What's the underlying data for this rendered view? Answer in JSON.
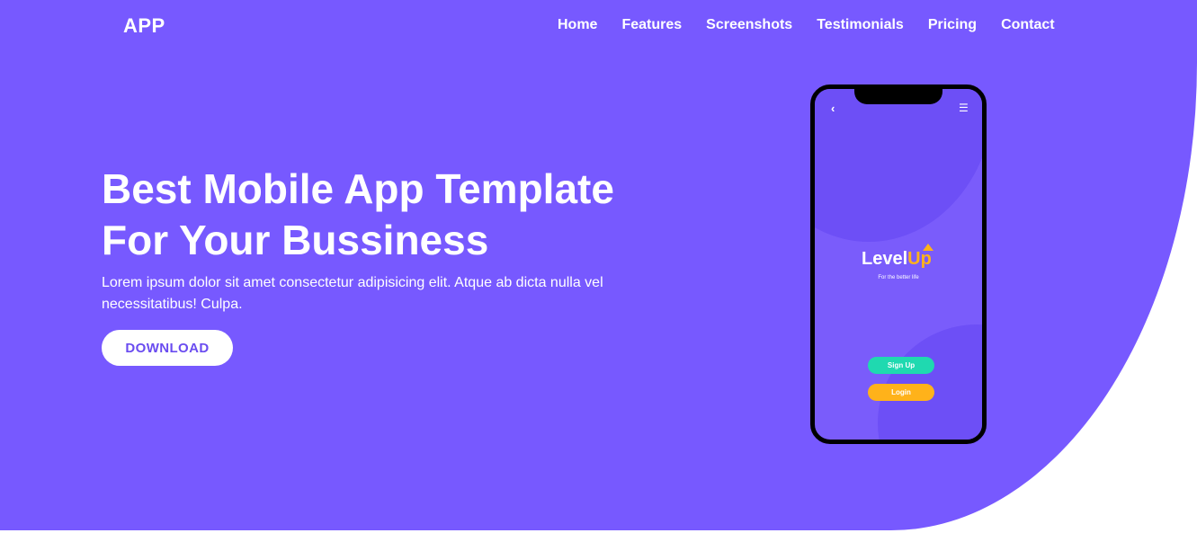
{
  "header": {
    "brand": "APP",
    "nav": [
      "Home",
      "Features",
      "Screenshots",
      "Testimonials",
      "Pricing",
      "Contact"
    ]
  },
  "hero": {
    "title_line1": "Best Mobile App Template",
    "title_line2": "For Your Bussiness",
    "subtitle": "Lorem ipsum dolor sit amet consectetur adipisicing elit. Atque ab dicta nulla vel necessitatibus! Culpa.",
    "cta_label": "DOWNLOAD"
  },
  "phone": {
    "back_icon": "chevron-left-icon",
    "menu_icon": "menu-icon",
    "logo_part1": "Level",
    "logo_part2": "Up",
    "tagline": "For the better life",
    "signup_label": "Sign Up",
    "login_label": "Login"
  },
  "colors": {
    "primary": "#7759ff",
    "accent_green": "#1fd9b0",
    "accent_orange": "#ffb21a"
  }
}
